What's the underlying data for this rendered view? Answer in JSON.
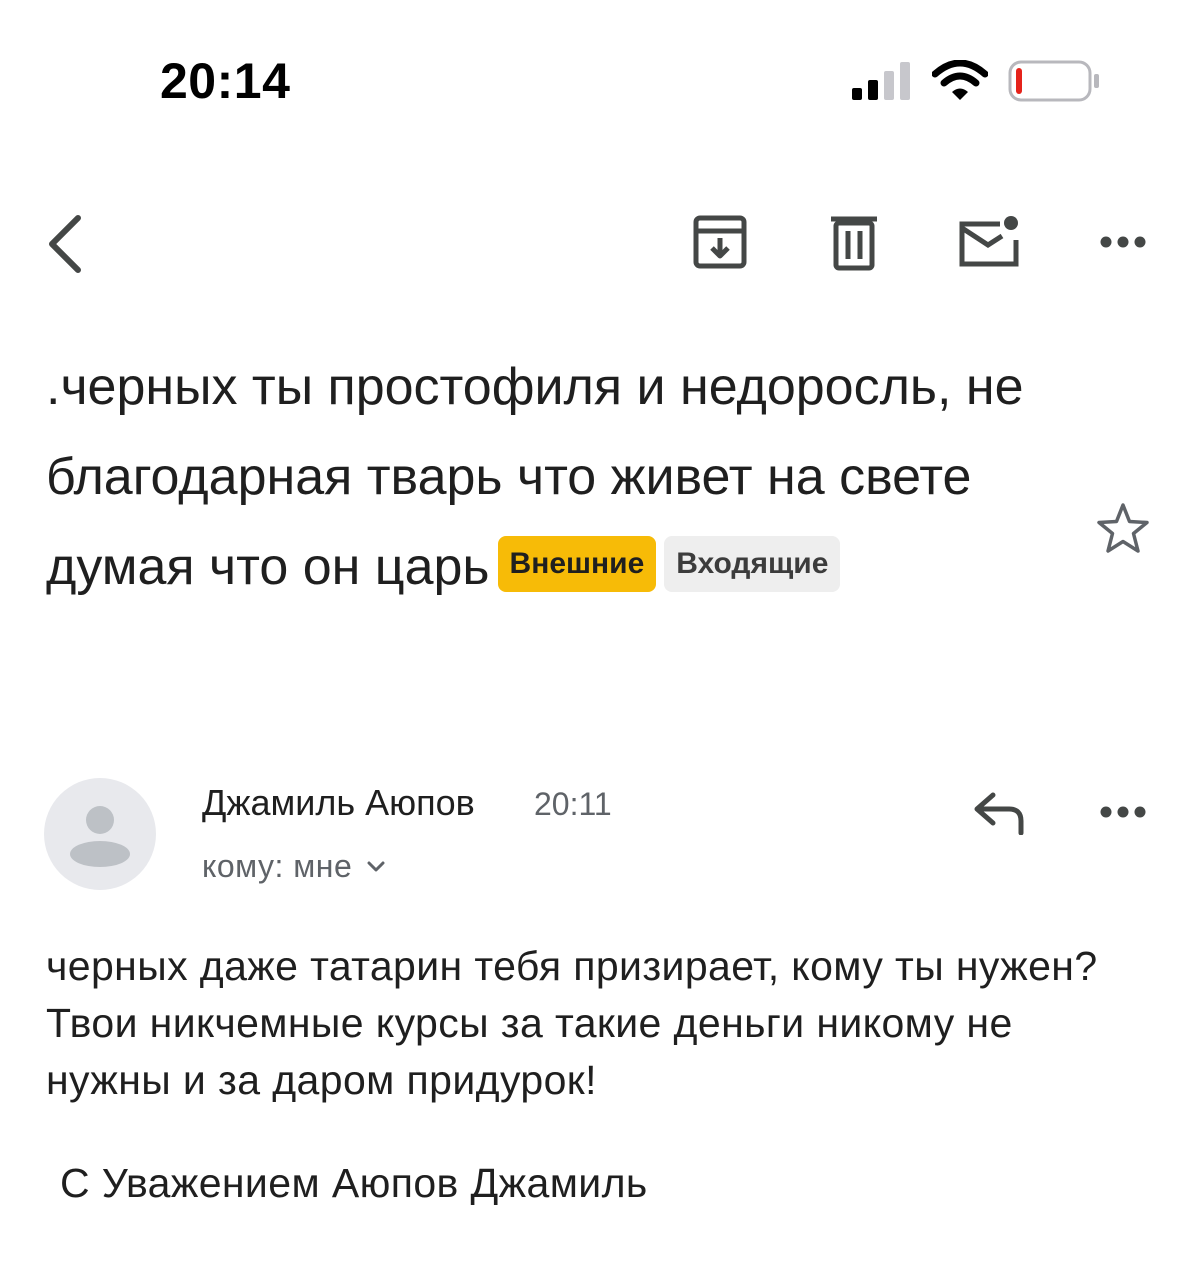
{
  "status_bar": {
    "time": "20:14",
    "icons": [
      "cellular-signal-icon",
      "wifi-icon",
      "battery-low-icon"
    ],
    "battery_color": "#e5231b"
  },
  "toolbar": {
    "icons": [
      "back-chevron-icon",
      "archive-icon",
      "trash-icon",
      "mark-unread-icon",
      "more-horizontal-icon"
    ]
  },
  "email": {
    "subject": ".черных ты простофиля и недоросль, не благодарная тварь что живет на свете думая что он царь",
    "labels": [
      {
        "text": "Внешние",
        "color": "#f7bb07"
      },
      {
        "text": "Входящие",
        "color": "#eeeeee"
      }
    ],
    "starred": false,
    "sender": {
      "name": "Джамиль Аюпов",
      "time": "20:11",
      "recipient_line": "кому: мне"
    },
    "body": "черных даже татарин тебя призирает, кому ты нужен? Твои никчемные курсы за такие деньги никому не нужны и за даром придурок!",
    "signature": "С Уважением Аюпов Джамиль"
  }
}
